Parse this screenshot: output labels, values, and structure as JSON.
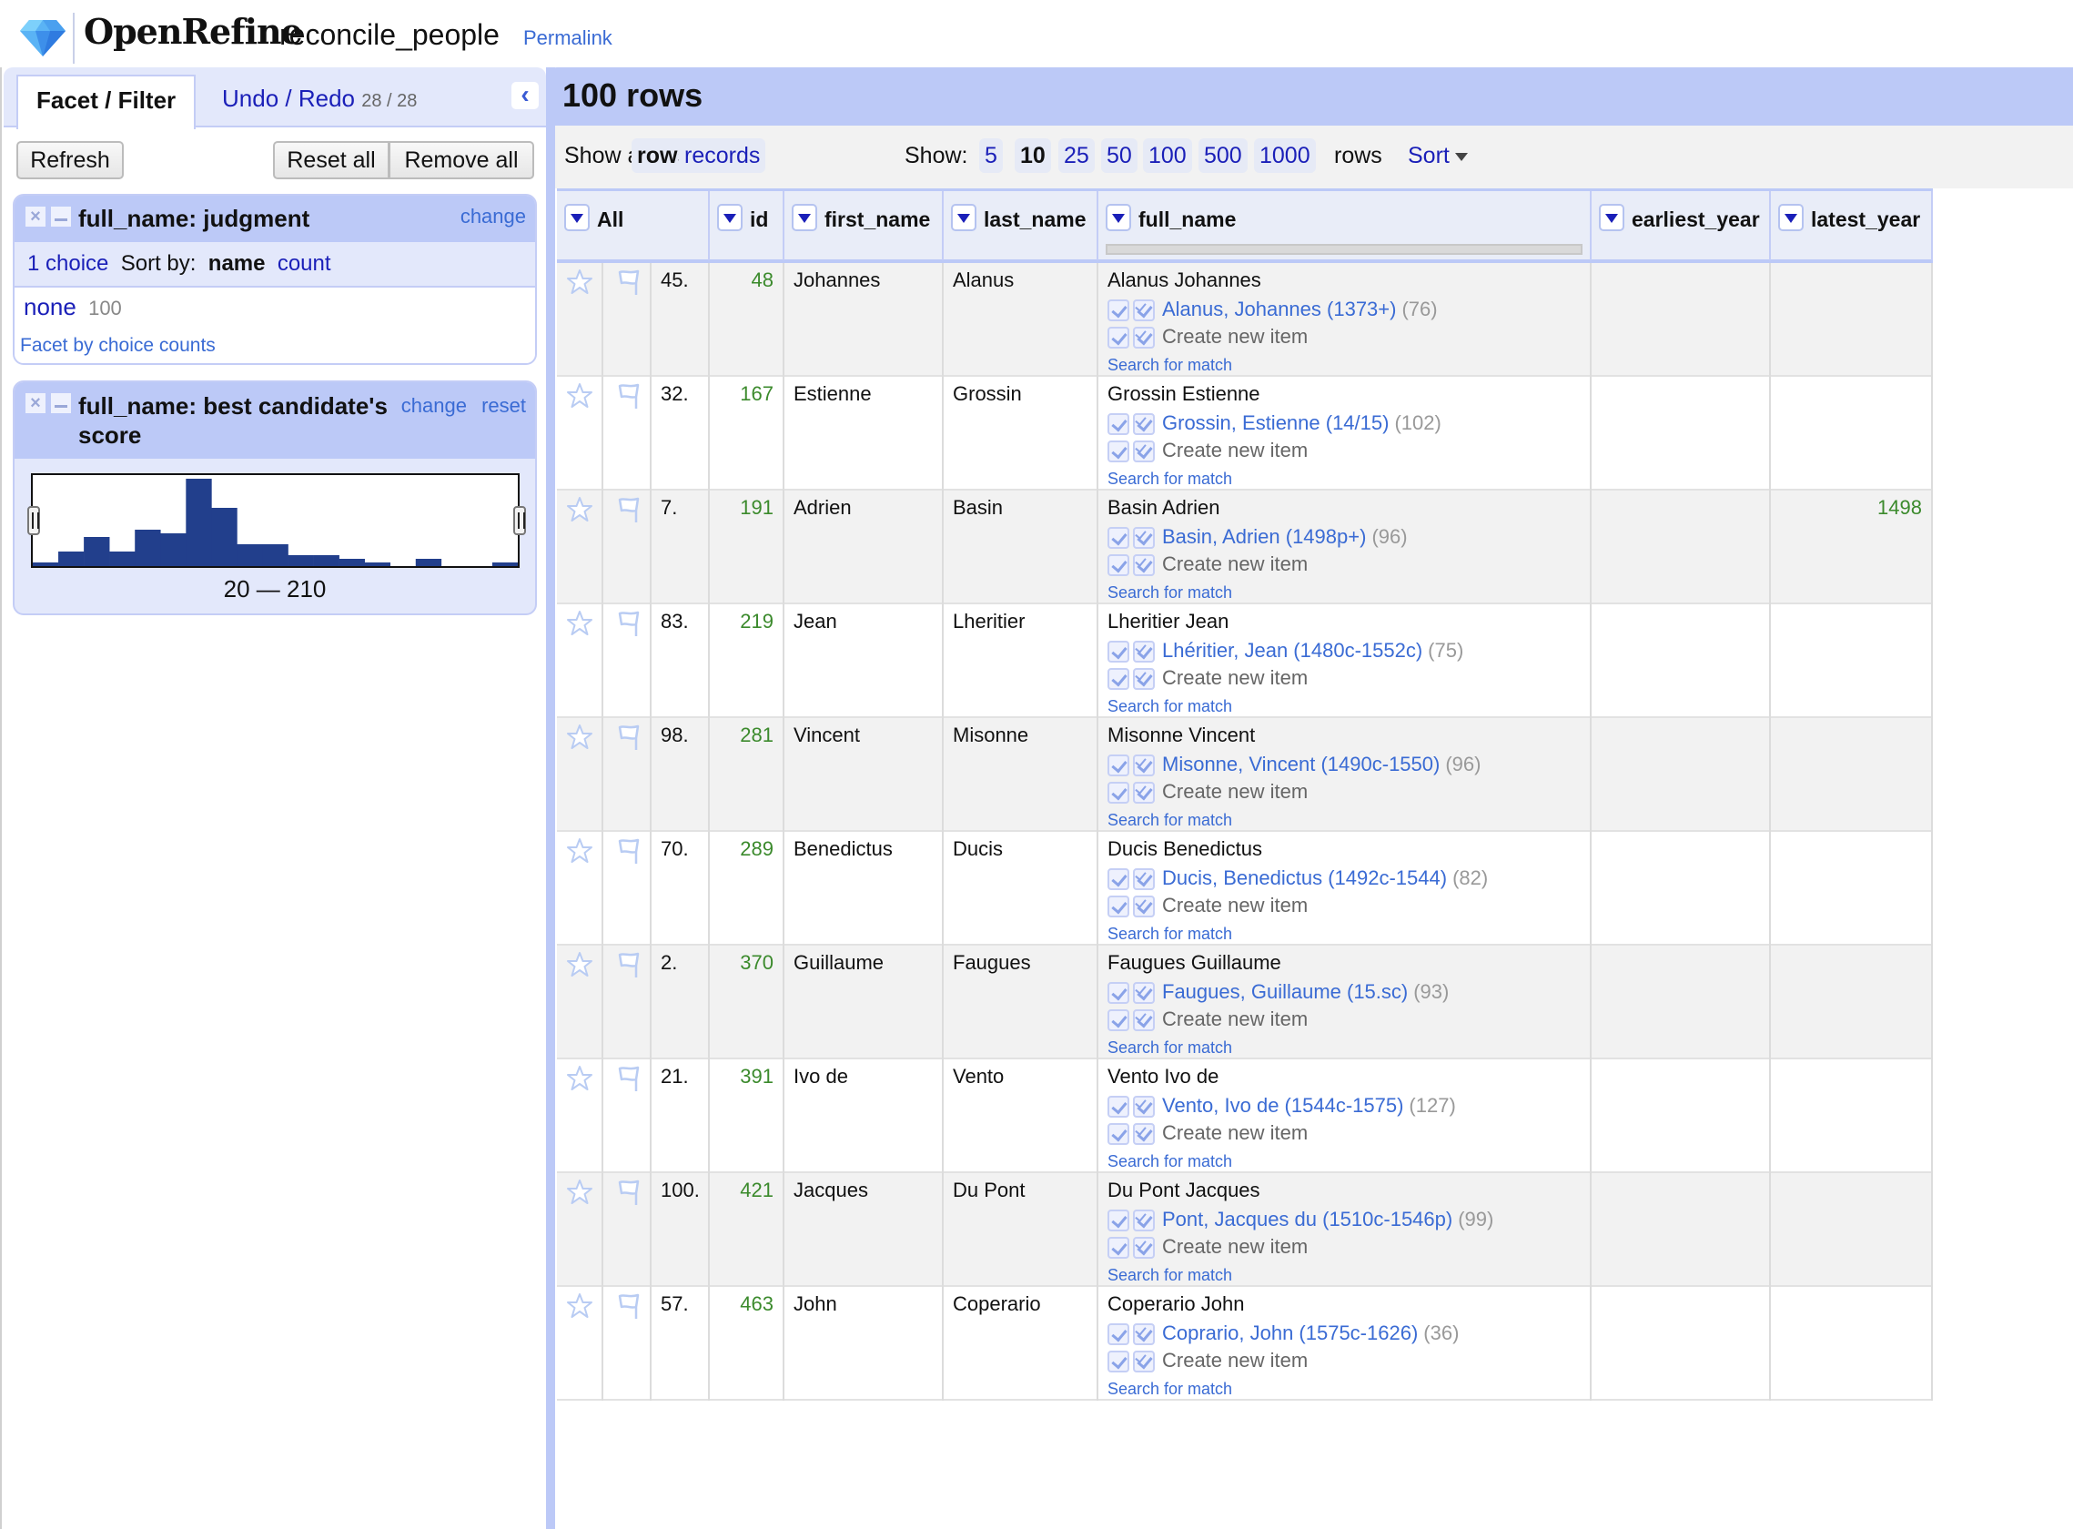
{
  "header": {
    "brand": "OpenRefine",
    "project_name": "reconcile_people",
    "permalink_label": "Permalink"
  },
  "left_panel": {
    "tabs": {
      "facet_filter": "Facet / Filter",
      "undo_redo": "Undo / Redo",
      "undo_count": "28 / 28"
    },
    "buttons": {
      "refresh": "Refresh",
      "reset_all": "Reset all",
      "remove_all": "Remove all"
    },
    "facets": [
      {
        "title": "full_name: judgment",
        "links": {
          "change": "change"
        },
        "choice_count_label": "1 choice",
        "sort_by_label": "Sort by:",
        "sort_name": "name",
        "sort_count": "count",
        "choices": [
          {
            "label": "none",
            "count": "100"
          }
        ],
        "facet_by_counts": "Facet by choice counts"
      },
      {
        "title": "full_name: best candidate's score",
        "links": {
          "change": "change",
          "reset": "reset"
        },
        "range_label": "20 — 210",
        "histogram": {
          "min": 20,
          "max": 210,
          "bin_width": 10,
          "counts": [
            1,
            4,
            8,
            4,
            10,
            9,
            24,
            16,
            6,
            6,
            3,
            3,
            2,
            1,
            0,
            2,
            0,
            0,
            1
          ],
          "selection": [
            20,
            210
          ],
          "bar_color": "#223f8c"
        }
      }
    ]
  },
  "main": {
    "row_count": "100 rows",
    "toolbar": {
      "show_as_label": "Show as:",
      "show_as_options": [
        {
          "label": "rows",
          "selected": true
        },
        {
          "label": "records",
          "selected": false
        }
      ],
      "show_label": "Show:",
      "page_sizes": [
        {
          "label": "5",
          "selected": false
        },
        {
          "label": "10",
          "selected": true
        },
        {
          "label": "25",
          "selected": false
        },
        {
          "label": "50",
          "selected": false
        },
        {
          "label": "100",
          "selected": false
        },
        {
          "label": "500",
          "selected": false
        },
        {
          "label": "1000",
          "selected": false
        }
      ],
      "rows_suffix": "rows",
      "sort_label": "Sort"
    },
    "columns": [
      "All",
      "id",
      "first_name",
      "last_name",
      "full_name",
      "earliest_year",
      "latest_year"
    ],
    "full_name_reconciled_fraction": 0,
    "candidate_labels": {
      "create_new": "Create new item",
      "search_for_match": "Search for match"
    },
    "rows": [
      {
        "row_num": "45.",
        "id": "48",
        "first_name": "Johannes",
        "last_name": "Alanus",
        "full_name": "Alanus Johannes",
        "candidate": "Alanus, Johannes (1373+)",
        "score": "(76)",
        "earliest_year": "",
        "latest_year": ""
      },
      {
        "row_num": "32.",
        "id": "167",
        "first_name": "Estienne",
        "last_name": "Grossin",
        "full_name": "Grossin Estienne",
        "candidate": "Grossin, Estienne (14/15)",
        "score": "(102)",
        "earliest_year": "",
        "latest_year": ""
      },
      {
        "row_num": "7.",
        "id": "191",
        "first_name": "Adrien",
        "last_name": "Basin",
        "full_name": "Basin Adrien",
        "candidate": "Basin, Adrien (1498p+)",
        "score": "(96)",
        "earliest_year": "",
        "latest_year": "1498"
      },
      {
        "row_num": "83.",
        "id": "219",
        "first_name": "Jean",
        "last_name": "Lheritier",
        "full_name": "Lheritier Jean",
        "candidate": "Lhéritier, Jean (1480c-1552c)",
        "score": "(75)",
        "earliest_year": "",
        "latest_year": ""
      },
      {
        "row_num": "98.",
        "id": "281",
        "first_name": "Vincent",
        "last_name": "Misonne",
        "full_name": "Misonne Vincent",
        "candidate": "Misonne, Vincent (1490c-1550)",
        "score": "(96)",
        "earliest_year": "",
        "latest_year": ""
      },
      {
        "row_num": "70.",
        "id": "289",
        "first_name": "Benedictus",
        "last_name": "Ducis",
        "full_name": "Ducis Benedictus",
        "candidate": "Ducis, Benedictus (1492c-1544)",
        "score": "(82)",
        "earliest_year": "",
        "latest_year": ""
      },
      {
        "row_num": "2.",
        "id": "370",
        "first_name": "Guillaume",
        "last_name": "Faugues",
        "full_name": "Faugues Guillaume",
        "candidate": "Faugues, Guillaume (15.sc)",
        "score": "(93)",
        "earliest_year": "",
        "latest_year": ""
      },
      {
        "row_num": "21.",
        "id": "391",
        "first_name": "Ivo de",
        "last_name": "Vento",
        "full_name": "Vento Ivo de",
        "candidate": "Vento, Ivo de (1544c-1575)",
        "score": "(127)",
        "earliest_year": "",
        "latest_year": ""
      },
      {
        "row_num": "100.",
        "id": "421",
        "first_name": "Jacques",
        "last_name": "Du Pont",
        "full_name": "Du Pont Jacques",
        "candidate": "Pont, Jacques du (1510c-1546p)",
        "score": "(99)",
        "earliest_year": "",
        "latest_year": ""
      },
      {
        "row_num": "57.",
        "id": "463",
        "first_name": "John",
        "last_name": "Coperario",
        "full_name": "Coperario John",
        "candidate": "Coprario, John (1575c-1626)",
        "score": "(36)",
        "earliest_year": "",
        "latest_year": ""
      }
    ]
  }
}
